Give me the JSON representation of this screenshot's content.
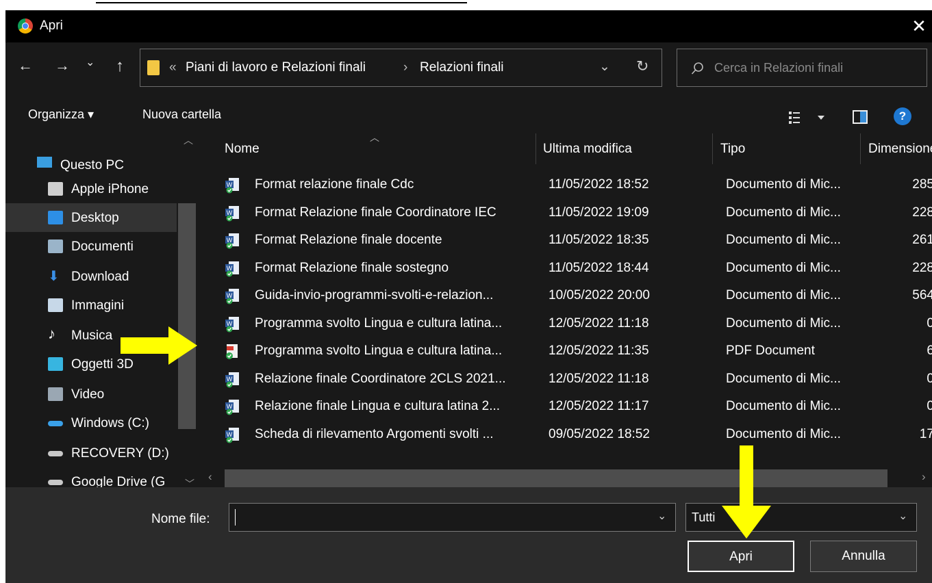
{
  "window": {
    "title": "Apri",
    "close_glyph": "✕"
  },
  "nav": {
    "back_glyph": "←",
    "forward_glyph": "→",
    "recent_glyph": "⌄",
    "up_glyph": "↑",
    "breadcrumb_prefix": "«",
    "breadcrumbs": [
      "Piani di lavoro e Relazioni finali",
      "Relazioni finali"
    ],
    "crumb_sep": "›",
    "dropdown_glyph": "⌄",
    "refresh_glyph": "↻"
  },
  "search": {
    "placeholder": "Cerca in Relazioni finali"
  },
  "toolbar": {
    "organize_label": "Organizza ▾",
    "new_folder_label": "Nuova cartella",
    "help_glyph": "?"
  },
  "sidebar": {
    "items": [
      {
        "label": "Questo PC",
        "icon": "pc-icon"
      },
      {
        "label": "Apple iPhone",
        "icon": "phone-icon"
      },
      {
        "label": "Desktop",
        "icon": "desktop-icon"
      },
      {
        "label": "Documenti",
        "icon": "documents-icon"
      },
      {
        "label": "Download",
        "icon": "download-icon"
      },
      {
        "label": "Immagini",
        "icon": "pictures-icon"
      },
      {
        "label": "Musica",
        "icon": "music-icon"
      },
      {
        "label": "Oggetti 3D",
        "icon": "objects3d-icon"
      },
      {
        "label": "Video",
        "icon": "video-icon"
      },
      {
        "label": "Windows (C:)",
        "icon": "drive-c-icon"
      },
      {
        "label": "RECOVERY (D:)",
        "icon": "drive-d-icon"
      },
      {
        "label": "Google Drive (G",
        "icon": "drive-g-icon"
      }
    ]
  },
  "columns": {
    "name": "Nome",
    "modified": "Ultima modifica",
    "type": "Tipo",
    "size": "Dimensione"
  },
  "files": [
    {
      "name": "Format relazione finale Cdc",
      "modified": "11/05/2022 18:52",
      "type": "Documento di Mic...",
      "size": "285",
      "kind": "word"
    },
    {
      "name": "Format Relazione finale Coordinatore IEC",
      "modified": "11/05/2022 19:09",
      "type": "Documento di Mic...",
      "size": "228",
      "kind": "word"
    },
    {
      "name": "Format Relazione finale docente",
      "modified": "11/05/2022 18:35",
      "type": "Documento di Mic...",
      "size": "261",
      "kind": "word"
    },
    {
      "name": "Format Relazione finale sostegno",
      "modified": "11/05/2022 18:44",
      "type": "Documento di Mic...",
      "size": "228",
      "kind": "word"
    },
    {
      "name": "Guida-invio-programmi-svolti-e-relazion...",
      "modified": "10/05/2022 20:00",
      "type": "Documento di Mic...",
      "size": "564",
      "kind": "word"
    },
    {
      "name": "Programma svolto Lingua e cultura latina...",
      "modified": "12/05/2022 11:18",
      "type": "Documento di Mic...",
      "size": "0",
      "kind": "word"
    },
    {
      "name": "Programma svolto Lingua e cultura latina...",
      "modified": "12/05/2022 11:35",
      "type": "PDF Document",
      "size": "6",
      "kind": "pdf"
    },
    {
      "name": "Relazione finale Coordinatore 2CLS 2021...",
      "modified": "12/05/2022 11:18",
      "type": "Documento di Mic...",
      "size": "0",
      "kind": "word"
    },
    {
      "name": "Relazione finale Lingua e cultura latina 2...",
      "modified": "12/05/2022 11:17",
      "type": "Documento di Mic...",
      "size": "0",
      "kind": "word"
    },
    {
      "name": "Scheda di rilevamento Argomenti svolti ...",
      "modified": "09/05/2022 18:52",
      "type": "Documento di Mic...",
      "size": "17",
      "kind": "word"
    }
  ],
  "footer": {
    "filename_label": "Nome file:",
    "filename_value": "",
    "filter_value": "Tutti",
    "open_label": "Apri",
    "cancel_label": "Annulla"
  },
  "colors": {
    "annotation_arrow": "#ffff00",
    "background": "#191919",
    "selected": "#333333"
  }
}
